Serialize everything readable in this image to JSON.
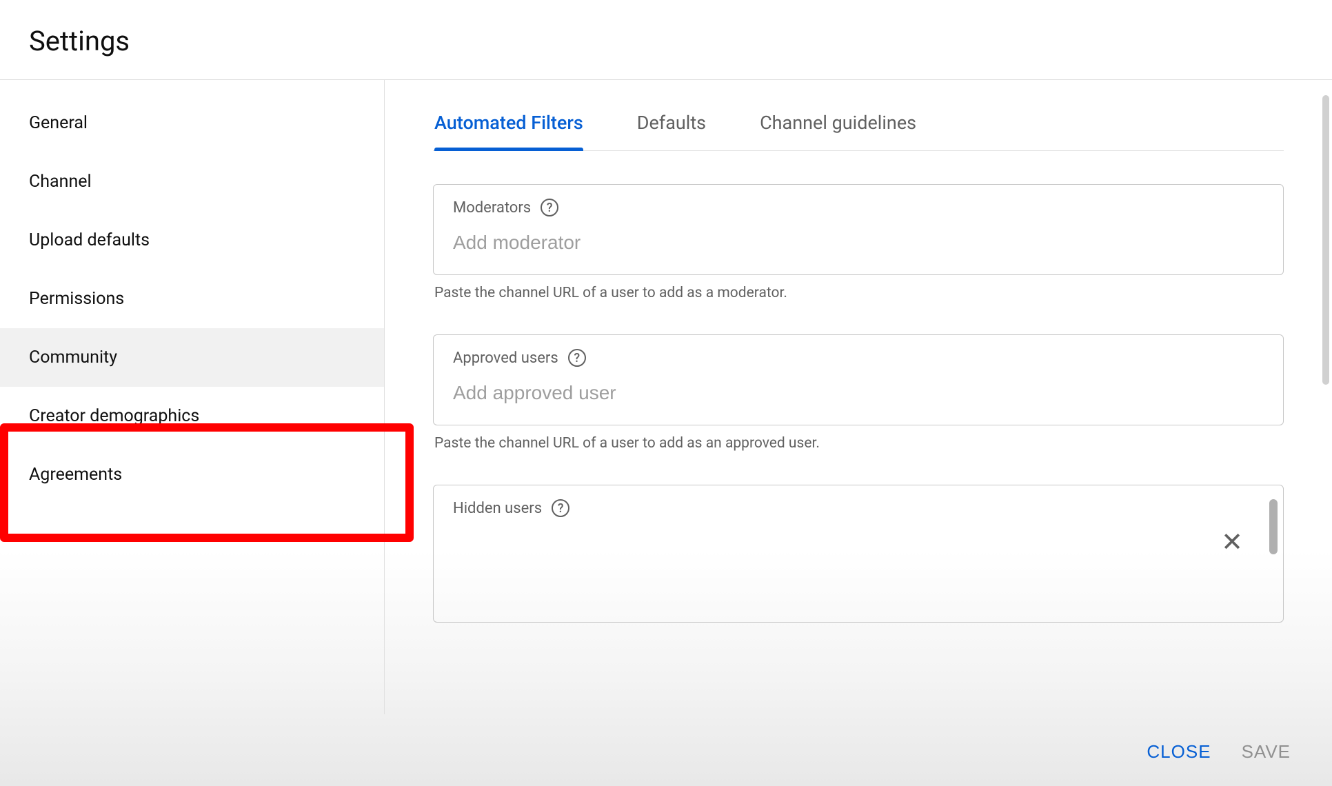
{
  "header": {
    "title": "Settings"
  },
  "sidebar": {
    "items": [
      {
        "label": "General"
      },
      {
        "label": "Channel"
      },
      {
        "label": "Upload defaults"
      },
      {
        "label": "Permissions"
      },
      {
        "label": "Community"
      },
      {
        "label": "Creator demographics"
      },
      {
        "label": "Agreements"
      }
    ],
    "selected_index": 4,
    "highlighted_index": 4
  },
  "tabs": {
    "items": [
      {
        "label": "Automated Filters"
      },
      {
        "label": "Defaults"
      },
      {
        "label": "Channel guidelines"
      }
    ],
    "active_index": 0
  },
  "fields": {
    "moderators": {
      "label": "Moderators",
      "placeholder": "Add moderator",
      "helper": "Paste the channel URL of a user to add as a moderator."
    },
    "approved_users": {
      "label": "Approved users",
      "placeholder": "Add approved user",
      "helper": "Paste the channel URL of a user to add as an approved user."
    },
    "hidden_users": {
      "label": "Hidden users"
    }
  },
  "footer": {
    "close_label": "CLOSE",
    "save_label": "SAVE"
  },
  "colors": {
    "accent": "#065fd4",
    "highlight": "#ff0000",
    "text_primary": "#0f0f0f",
    "text_secondary": "#606060"
  }
}
